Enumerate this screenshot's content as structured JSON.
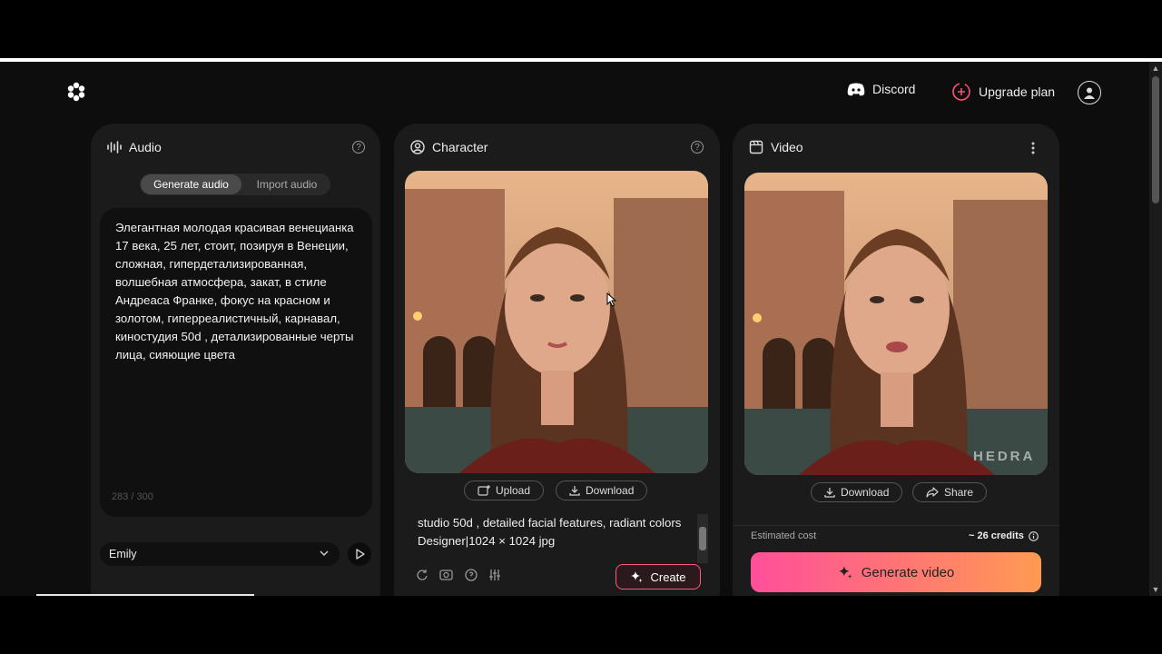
{
  "header": {
    "discord_label": "Discord",
    "upgrade_label": "Upgrade plan"
  },
  "audio_panel": {
    "title": "Audio",
    "tab_generate": "Generate audio",
    "tab_import": "Import audio",
    "script_text": "Элегантная молодая красивая венецианка 17 века, 25 лет, стоит, позируя в Венеции, сложная, гипердетализированная, волшебная атмосфера, закат, в стиле Андреаса Франке, фокус на красном и золотом, гиперреалистичный, карнавал, киностудия 50d , детализированные черты лица, сияющие цвета",
    "char_count": "283 / 300",
    "voice": "Emily"
  },
  "character_panel": {
    "title": "Character",
    "upload_label": "Upload",
    "download_label": "Download",
    "prompt_line1": "studio 50d , detailed facial features, radiant colors",
    "prompt_line2": "Designer|1024 × 1024 jpg",
    "create_label": "Create"
  },
  "video_panel": {
    "title": "Video",
    "download_label": "Download",
    "share_label": "Share",
    "watermark": "HEDRA",
    "cost_label": "Estimated cost",
    "cost_value": "~ 26 credits",
    "generate_label": "Generate video"
  },
  "colors": {
    "accent_pink": "#ff4f9a",
    "accent_orange": "#ff9a52",
    "panel_bg": "#1b1b1b"
  }
}
